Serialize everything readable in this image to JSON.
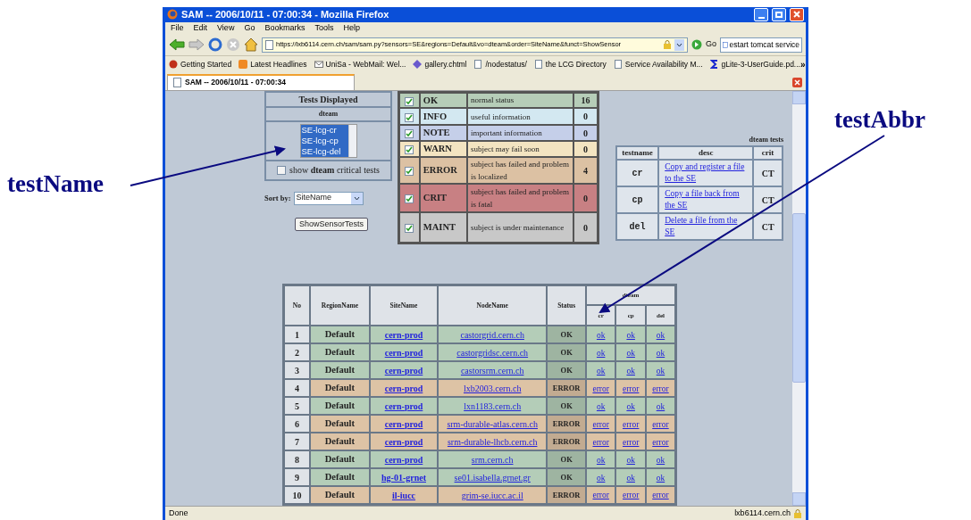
{
  "window": {
    "title": "SAM -- 2006/10/11 - 07:00:34 - Mozilla Firefox"
  },
  "menu": [
    "File",
    "Edit",
    "View",
    "Go",
    "Bookmarks",
    "Tools",
    "Help"
  ],
  "navigation": {
    "url": "https://lxb6114.cern.ch/sam/sam.py?sensors=SE&regions=Default&vo=dteam&order=SiteName&funct=ShowSensor",
    "go": "Go",
    "search_value": "estart tomcat service"
  },
  "bookmarks": [
    {
      "label": "Getting Started",
      "kind": "firefox"
    },
    {
      "label": "Latest Headlines",
      "kind": "feed"
    },
    {
      "label": "UniSa - WebMail: Wel...",
      "kind": "mail"
    },
    {
      "label": "gallery.chtml",
      "kind": "diamond"
    },
    {
      "label": "/nodestatus/",
      "kind": "page"
    },
    {
      "label": "the LCG Directory",
      "kind": "page"
    },
    {
      "label": "Service Availability M...",
      "kind": "page"
    },
    {
      "label": "gLite-3-UserGuide.pd...",
      "kind": "sigma"
    }
  ],
  "bookmarks_more": "»",
  "tab": {
    "title": "SAM -- 2006/10/11 - 07:00:34"
  },
  "tests_panel": {
    "title": "Tests Displayed",
    "vo": "dteam",
    "tests": [
      {
        "label": "SE-lcg-cr",
        "selected": true
      },
      {
        "label": "SE-lcg-cp",
        "selected": true
      },
      {
        "label": "SE-lcg-del",
        "selected": true
      }
    ],
    "critical": {
      "label": "show **dteam** critical tests",
      "checked": false
    },
    "sort_label": "Sort by:",
    "sort_value": "SiteName",
    "button": "ShowSensorTests"
  },
  "legend": [
    {
      "code": "OK",
      "desc": "normal status",
      "count": "16",
      "checked": true,
      "color": "#b6cdb8"
    },
    {
      "code": "INFO",
      "desc": "useful information",
      "count": "0",
      "checked": true,
      "color": "#d3e8f1"
    },
    {
      "code": "NOTE",
      "desc": "important information",
      "count": "0",
      "checked": true,
      "color": "#c5cfe9"
    },
    {
      "code": "WARN",
      "desc": "subject may fail soon",
      "count": "0",
      "checked": true,
      "color": "#f3e4c1"
    },
    {
      "code": "ERROR",
      "desc": "subject has failed and problem is localized",
      "count": "4",
      "checked": true,
      "color": "#dcc1a3"
    },
    {
      "code": "CRIT",
      "desc": "subject has failed and problem is fatal",
      "count": "0",
      "checked": true,
      "color": "#c88083"
    },
    {
      "code": "MAINT",
      "desc": "subject is under maintenance",
      "count": "0",
      "checked": true,
      "color": "#c8c8c8"
    }
  ],
  "tests_table": {
    "caption": "dteam tests",
    "columns": [
      "testname",
      "desc",
      "crit"
    ],
    "rows": [
      {
        "name": "cr",
        "desc": "Copy and register a file to the SE",
        "crit": "CT"
      },
      {
        "name": "cp",
        "desc": "Copy a file back from the SE",
        "crit": "CT"
      },
      {
        "name": "del",
        "desc": "Delete a file from the SE",
        "crit": "CT"
      }
    ]
  },
  "sites_table": {
    "columns": [
      "No",
      "RegionName",
      "SiteName",
      "NodeName",
      "Status"
    ],
    "group": "dteam",
    "tests": [
      "cr",
      "cp",
      "del"
    ],
    "rows": [
      {
        "no": "1",
        "region": "Default",
        "site": "cern-prod",
        "node": "castorgrid.cern.ch",
        "status": "OK",
        "color": "#b4cdb8",
        "results": [
          "ok",
          "ok",
          "ok"
        ]
      },
      {
        "no": "2",
        "region": "Default",
        "site": "cern-prod",
        "node": "castorgridsc.cern.ch",
        "status": "OK",
        "color": "#b4cdb8",
        "results": [
          "ok",
          "ok",
          "ok"
        ]
      },
      {
        "no": "3",
        "region": "Default",
        "site": "cern-prod",
        "node": "castorsrm.cern.ch",
        "status": "OK",
        "color": "#b4cdb8",
        "results": [
          "ok",
          "ok",
          "ok"
        ]
      },
      {
        "no": "4",
        "region": "Default",
        "site": "cern-prod",
        "node": "lxb2003.cern.ch",
        "status": "ERROR",
        "color": "#ddc3a5",
        "results": [
          "error",
          "error",
          "error"
        ]
      },
      {
        "no": "5",
        "region": "Default",
        "site": "cern-prod",
        "node": "lxn1183.cern.ch",
        "status": "OK",
        "color": "#b4cdb8",
        "results": [
          "ok",
          "ok",
          "ok"
        ]
      },
      {
        "no": "6",
        "region": "Default",
        "site": "cern-prod",
        "node": "srm-durable-atlas.cern.ch",
        "status": "ERROR",
        "color": "#ddc3a5",
        "results": [
          "error",
          "error",
          "error"
        ]
      },
      {
        "no": "7",
        "region": "Default",
        "site": "cern-prod",
        "node": "srm-durable-lhcb.cern.ch",
        "status": "ERROR",
        "color": "#ddc3a5",
        "results": [
          "error",
          "error",
          "error"
        ]
      },
      {
        "no": "8",
        "region": "Default",
        "site": "cern-prod",
        "node": "srm.cern.ch",
        "status": "OK",
        "color": "#b4cdb8",
        "results": [
          "ok",
          "ok",
          "ok"
        ]
      },
      {
        "no": "9",
        "region": "Default",
        "site": "hg-01-grnet",
        "node": "se01.isabella.grnet.gr",
        "status": "OK",
        "color": "#b4cdb8",
        "results": [
          "ok",
          "ok",
          "ok"
        ]
      },
      {
        "no": "10",
        "region": "Default",
        "site": "il-iucc",
        "node": "grim-se.iucc.ac.il",
        "status": "ERROR",
        "color": "#ddc3a5",
        "results": [
          "error",
          "error",
          "error"
        ]
      }
    ]
  },
  "status_bar": {
    "text": "Done",
    "host": "lxb6114.cern.ch"
  },
  "annotations": [
    {
      "text": "testName"
    },
    {
      "text": "testAbbr"
    }
  ]
}
